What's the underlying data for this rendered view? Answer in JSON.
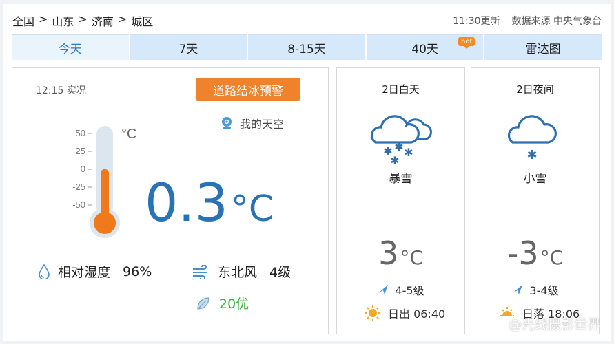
{
  "breadcrumb": [
    "全国",
    "山东",
    "济南",
    "城区"
  ],
  "breadcrumb_sep": ">",
  "header": {
    "updated": "11:30更新",
    "source": "数据来源 中央气象台"
  },
  "tabs": [
    {
      "label": "今天",
      "active": true
    },
    {
      "label": "7天"
    },
    {
      "label": "8-15天"
    },
    {
      "label": "40天",
      "badge": "hot"
    },
    {
      "label": "雷达图"
    }
  ],
  "current": {
    "obs_time": "12:15 实况",
    "warning": "道路结冰预警",
    "my_sky": "我的天空",
    "thermometer": {
      "ticks": [
        "50",
        "25",
        "0",
        "-25",
        "-50"
      ],
      "unit": "°C",
      "value": 0.3
    },
    "temperature": "0.3",
    "temp_unit": "°C",
    "humidity_label": "相对湿度",
    "humidity_value": "96%",
    "wind_dir": "东北风",
    "wind_level": "4级",
    "air_quality": "20优"
  },
  "forecast": [
    {
      "title": "2日白天",
      "weather": "暴雪",
      "icon": "heavy-snow-icon",
      "temp": "3",
      "unit": "°C",
      "wind": "4-5级",
      "sun_event": "日出 06:40"
    },
    {
      "title": "2日夜间",
      "weather": "小雪",
      "icon": "light-snow-icon",
      "temp": "-3",
      "unit": "°C",
      "wind": "3-4级",
      "sun_event": "日落 18:06"
    }
  ],
  "watermark": "@光线摄影世界",
  "colors": {
    "accent": "#2a72b6",
    "warning": "#f0822c",
    "tab_bg": "#d6e9fb",
    "aq_good": "#3cae3c",
    "thermo_fill": "#f07a1a"
  }
}
